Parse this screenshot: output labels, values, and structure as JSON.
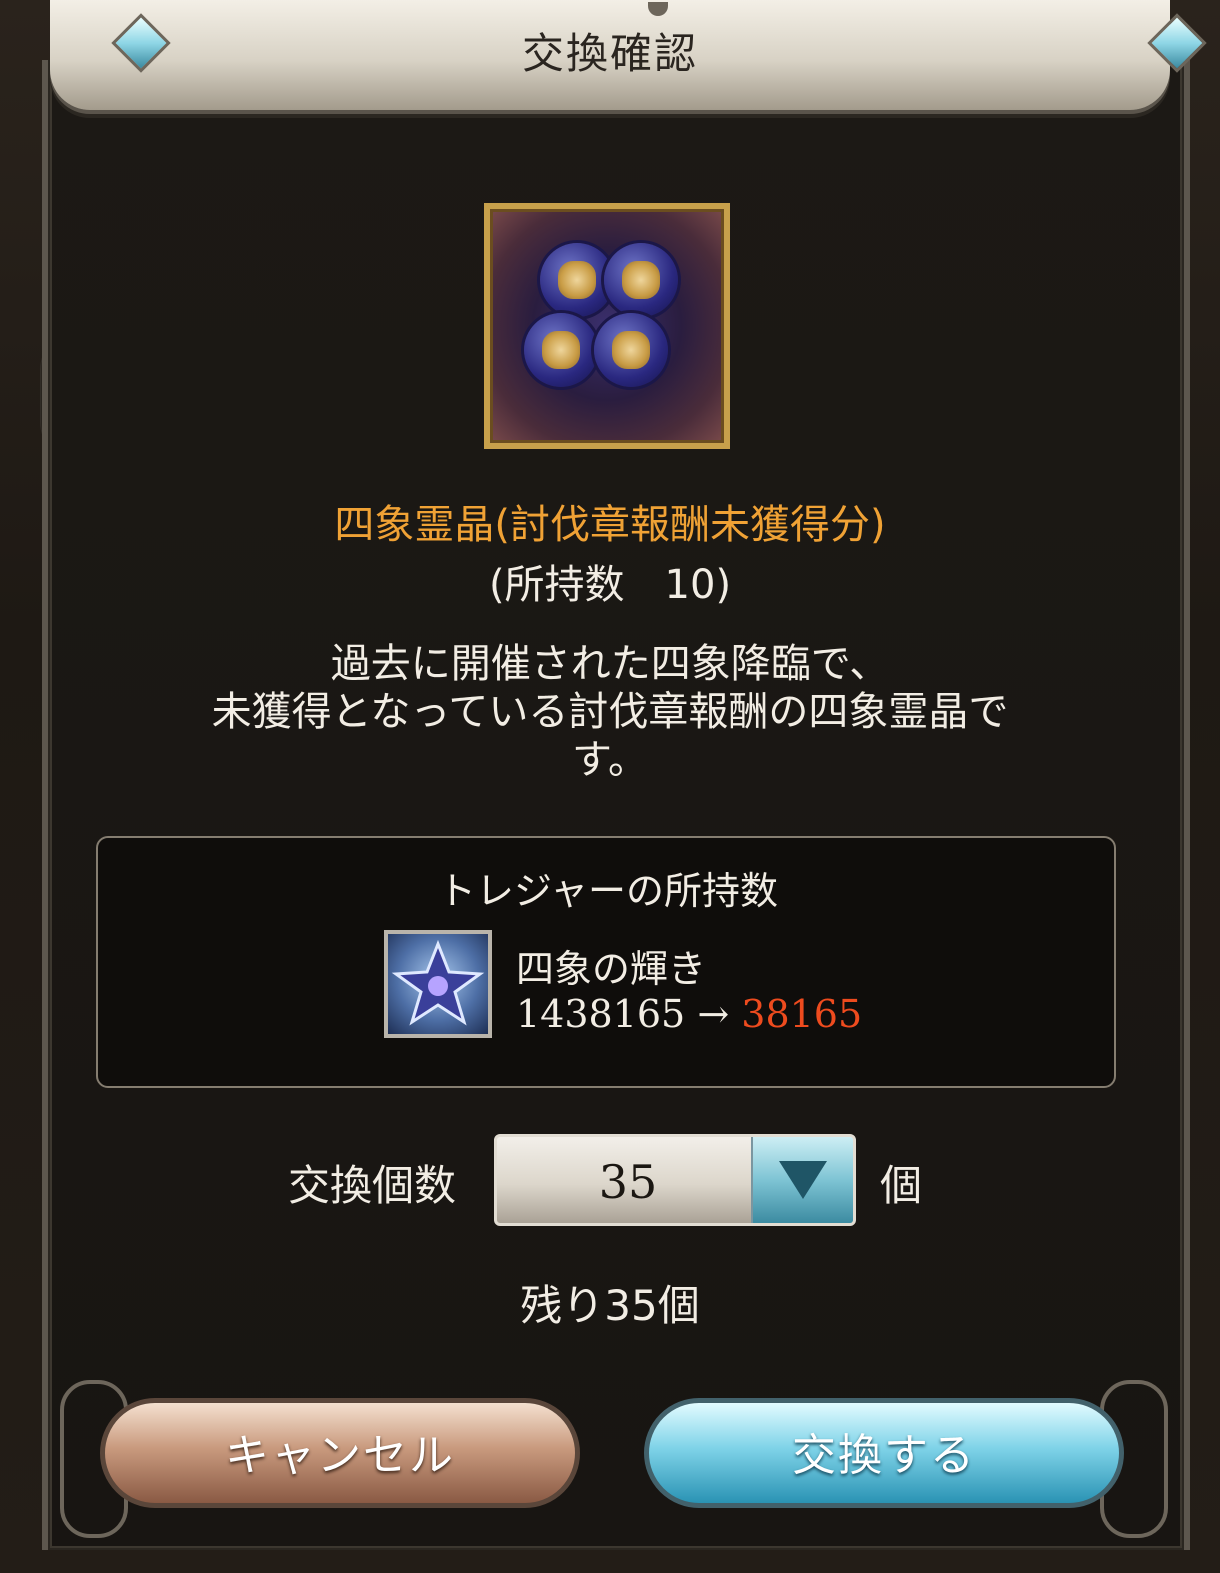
{
  "dialog": {
    "title": "交換確認"
  },
  "item": {
    "icon": "four-symbols-crystal-icon",
    "name": "四象霊晶(討伐章報酬未獲得分)",
    "owned_text": "(所持数　10)",
    "description_lines": [
      "過去に開催された四象降臨で、",
      "未獲得となっている討伐章報酬の四象霊晶で",
      "す。"
    ]
  },
  "treasure": {
    "header": "トレジャーの所持数",
    "icon": "star-gem-icon",
    "name": "四象の輝き",
    "count_before": "1438165",
    "arrow": "→",
    "count_after": "38165"
  },
  "quantity": {
    "label": "交換個数",
    "value": "35",
    "unit": "個",
    "remaining": "残り35個"
  },
  "buttons": {
    "cancel": "キャンセル",
    "exchange": "交換する"
  },
  "colors": {
    "item_name": "#f0a235",
    "count_after": "#ee4b1e",
    "exchange_button": "#7fd3e8",
    "cancel_button": "#c99a7e"
  }
}
